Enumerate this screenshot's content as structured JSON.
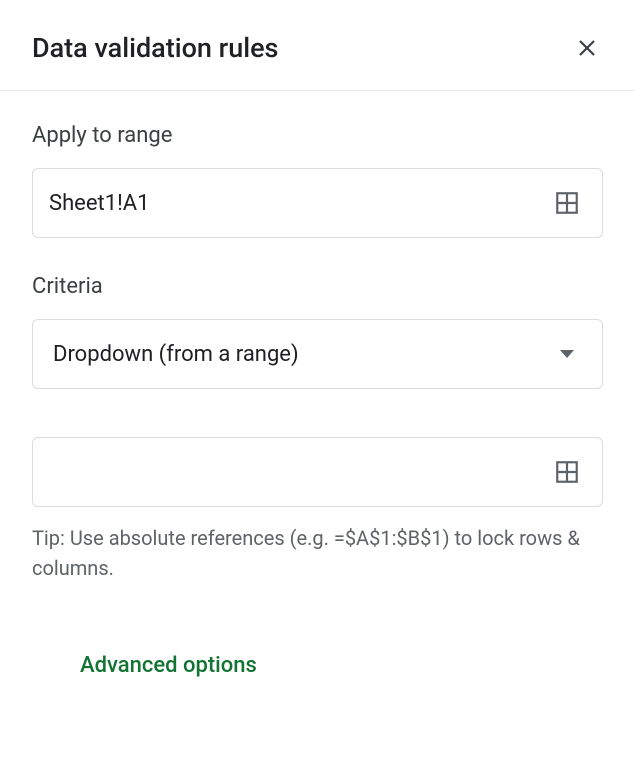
{
  "header": {
    "title": "Data validation rules"
  },
  "apply_section": {
    "label": "Apply to range",
    "value": "Sheet1!A1"
  },
  "criteria_section": {
    "label": "Criteria",
    "selected": "Dropdown (from a range)"
  },
  "range_source": {
    "value": "",
    "tip": "Tip: Use absolute references (e.g. =$A$1:$B$1) to lock rows & columns."
  },
  "advanced": {
    "label": "Advanced options"
  }
}
